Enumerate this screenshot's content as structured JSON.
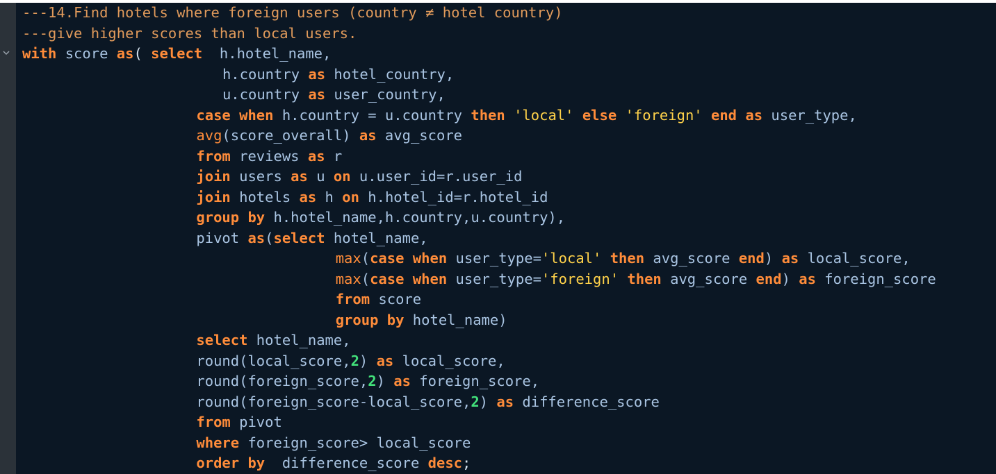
{
  "editor": {
    "fold_icon": "chevron-down-icon",
    "lines": [
      {
        "indent": 0,
        "tokens": [
          [
            "cm",
            "---14.Find hotels where foreign users (country ≠ hotel country)"
          ]
        ]
      },
      {
        "indent": 0,
        "tokens": [
          [
            "cm",
            "---give higher scores than local users."
          ]
        ]
      },
      {
        "indent": 0,
        "tokens": [
          [
            "kw",
            "with"
          ],
          [
            "id",
            " score "
          ],
          [
            "kw",
            "as"
          ],
          [
            "pc",
            "( "
          ],
          [
            "kw",
            "select"
          ],
          [
            "id",
            "  h.hotel_name,"
          ]
        ]
      },
      {
        "indent": 23,
        "tokens": [
          [
            "id",
            "h.country "
          ],
          [
            "kw",
            "as"
          ],
          [
            "id",
            " hotel_country,"
          ]
        ]
      },
      {
        "indent": 23,
        "tokens": [
          [
            "id",
            "u.country "
          ],
          [
            "kw",
            "as"
          ],
          [
            "id",
            " user_country,"
          ]
        ]
      },
      {
        "indent": 20,
        "tokens": [
          [
            "kw",
            "case when"
          ],
          [
            "id",
            " h.country = u.country "
          ],
          [
            "kw",
            "then"
          ],
          [
            "id",
            " "
          ],
          [
            "st",
            "'local'"
          ],
          [
            "id",
            " "
          ],
          [
            "kw",
            "else"
          ],
          [
            "id",
            " "
          ],
          [
            "st",
            "'foreign'"
          ],
          [
            "id",
            " "
          ],
          [
            "kw",
            "end"
          ],
          [
            "id",
            " "
          ],
          [
            "kw",
            "as"
          ],
          [
            "id",
            " user_type,"
          ]
        ]
      },
      {
        "indent": 20,
        "tokens": [
          [
            "fn",
            "avg"
          ],
          [
            "id",
            "(score_overall) "
          ],
          [
            "kw",
            "as"
          ],
          [
            "id",
            " avg_score"
          ]
        ]
      },
      {
        "indent": 20,
        "tokens": [
          [
            "kw",
            "from"
          ],
          [
            "id",
            " reviews "
          ],
          [
            "kw",
            "as"
          ],
          [
            "id",
            " r"
          ]
        ]
      },
      {
        "indent": 20,
        "tokens": [
          [
            "kw",
            "join"
          ],
          [
            "id",
            " users "
          ],
          [
            "kw",
            "as"
          ],
          [
            "id",
            " u "
          ],
          [
            "kw",
            "on"
          ],
          [
            "id",
            " u.user_id=r.user_id"
          ]
        ]
      },
      {
        "indent": 20,
        "tokens": [
          [
            "kw",
            "join"
          ],
          [
            "id",
            " hotels "
          ],
          [
            "kw",
            "as"
          ],
          [
            "id",
            " h "
          ],
          [
            "kw",
            "on"
          ],
          [
            "id",
            " h.hotel_id=r.hotel_id"
          ]
        ]
      },
      {
        "indent": 20,
        "tokens": [
          [
            "kw",
            "group by"
          ],
          [
            "id",
            " h.hotel_name,h.country,u.country),"
          ]
        ]
      },
      {
        "indent": 20,
        "tokens": [
          [
            "id",
            "pivot "
          ],
          [
            "kw",
            "as"
          ],
          [
            "id",
            "("
          ],
          [
            "kw",
            "select"
          ],
          [
            "id",
            " hotel_name,"
          ]
        ]
      },
      {
        "indent": 36,
        "tokens": [
          [
            "fn",
            "max"
          ],
          [
            "id",
            "("
          ],
          [
            "kw",
            "case when"
          ],
          [
            "id",
            " user_type="
          ],
          [
            "st",
            "'local'"
          ],
          [
            "id",
            " "
          ],
          [
            "kw",
            "then"
          ],
          [
            "id",
            " avg_score "
          ],
          [
            "kw",
            "end"
          ],
          [
            "id",
            ") "
          ],
          [
            "kw",
            "as"
          ],
          [
            "id",
            " local_score,"
          ]
        ]
      },
      {
        "indent": 36,
        "tokens": [
          [
            "fn",
            "max"
          ],
          [
            "id",
            "("
          ],
          [
            "kw",
            "case when"
          ],
          [
            "id",
            " user_type="
          ],
          [
            "st",
            "'foreign'"
          ],
          [
            "id",
            " "
          ],
          [
            "kw",
            "then"
          ],
          [
            "id",
            " avg_score "
          ],
          [
            "kw",
            "end"
          ],
          [
            "id",
            ") "
          ],
          [
            "kw",
            "as"
          ],
          [
            "id",
            " foreign_score"
          ]
        ]
      },
      {
        "indent": 36,
        "tokens": [
          [
            "kw",
            "from"
          ],
          [
            "id",
            " score"
          ]
        ]
      },
      {
        "indent": 36,
        "tokens": [
          [
            "kw",
            "group by"
          ],
          [
            "id",
            " hotel_name)"
          ]
        ]
      },
      {
        "indent": 20,
        "tokens": [
          [
            "kw",
            "select"
          ],
          [
            "id",
            " hotel_name,"
          ]
        ]
      },
      {
        "indent": 20,
        "tokens": [
          [
            "id",
            "round(local_score,"
          ],
          [
            "nm",
            "2"
          ],
          [
            "id",
            ") "
          ],
          [
            "kw",
            "as"
          ],
          [
            "id",
            " local_score,"
          ]
        ]
      },
      {
        "indent": 20,
        "tokens": [
          [
            "id",
            "round(foreign_score,"
          ],
          [
            "nm",
            "2"
          ],
          [
            "id",
            ") "
          ],
          [
            "kw",
            "as"
          ],
          [
            "id",
            " foreign_score,"
          ]
        ]
      },
      {
        "indent": 20,
        "tokens": [
          [
            "id",
            "round(foreign_score-local_score,"
          ],
          [
            "nm",
            "2"
          ],
          [
            "id",
            ") "
          ],
          [
            "kw",
            "as"
          ],
          [
            "id",
            " difference_score"
          ]
        ]
      },
      {
        "indent": 20,
        "tokens": [
          [
            "kw",
            "from"
          ],
          [
            "id",
            " pivot"
          ]
        ]
      },
      {
        "indent": 20,
        "tokens": [
          [
            "kw",
            "where"
          ],
          [
            "id",
            " foreign_score> local_score"
          ]
        ]
      },
      {
        "indent": 20,
        "tokens": [
          [
            "kw",
            "order by"
          ],
          [
            "id",
            "  difference_score "
          ],
          [
            "kw",
            "desc"
          ],
          [
            "pc",
            ";"
          ]
        ]
      }
    ]
  }
}
